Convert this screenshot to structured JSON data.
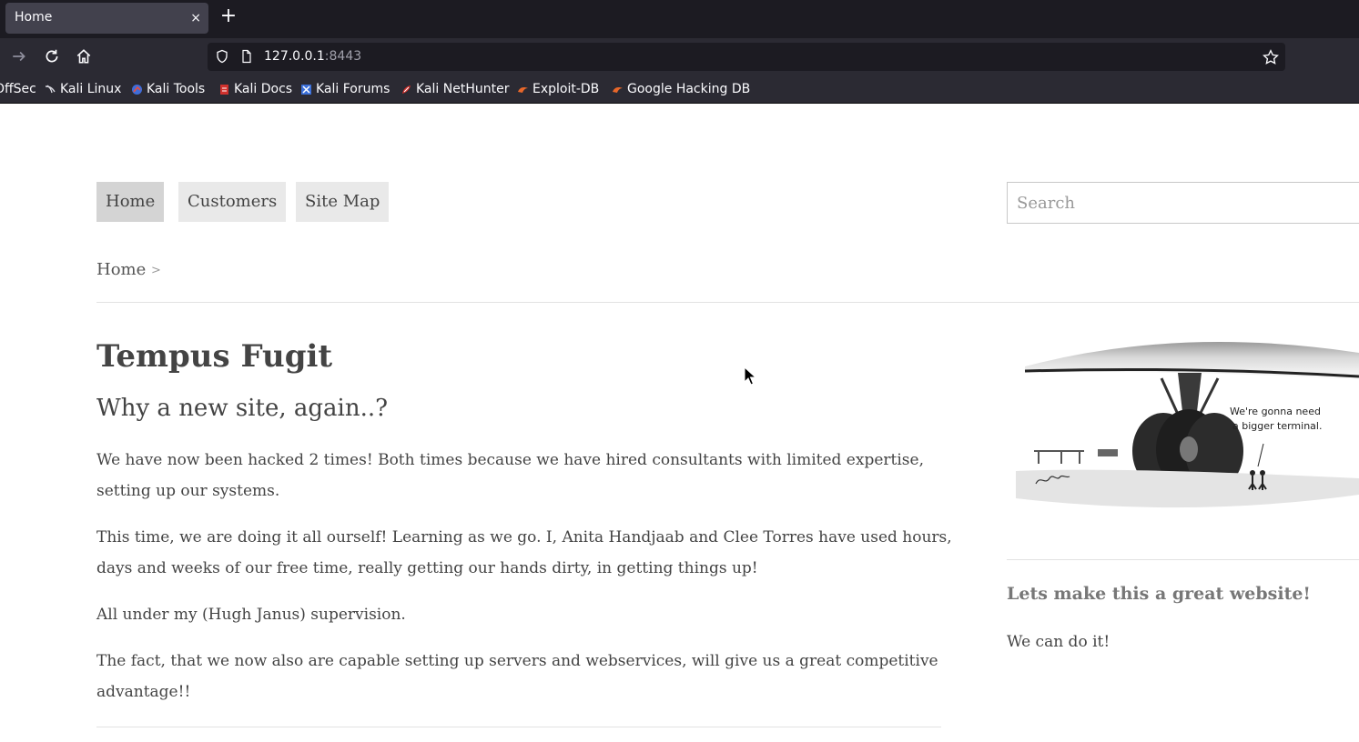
{
  "browser": {
    "tab_title": "Home",
    "tab_close": "×",
    "new_tab": "+",
    "url_host": "127.0.0.1",
    "url_port": ":8443",
    "bookmarks": [
      {
        "label": "OffSec",
        "icon": "offsec-icon"
      },
      {
        "label": "Kali Linux",
        "icon": "kali-dragon-icon"
      },
      {
        "label": "Kali Tools",
        "icon": "kali-tools-icon"
      },
      {
        "label": "Kali Docs",
        "icon": "kali-docs-icon"
      },
      {
        "label": "Kali Forums",
        "icon": "kali-forums-icon"
      },
      {
        "label": "Kali NetHunter",
        "icon": "kali-nethunter-icon"
      },
      {
        "label": "Exploit-DB",
        "icon": "exploit-db-icon"
      },
      {
        "label": "Google Hacking DB",
        "icon": "ghdb-icon"
      }
    ]
  },
  "site": {
    "menu": [
      "Home",
      "Customers",
      "Site Map"
    ],
    "search_placeholder": "Search",
    "breadcrumb": "Home",
    "breadcrumb_sep": ">",
    "title": "Tempus Fugit",
    "subtitle": "Why a new site, again..?",
    "paragraphs": [
      "We have now been hacked 2 times! Both times because we have hired consultants with limited expertise, setting up our systems.",
      "This time, we are doing it all ourself! Learning as we go. I, Anita Handjaab and Clee Torres have used hours, days and weeks of our free time, really getting our hands dirty, in getting things up!",
      "All under my (Hugh Janus) supervision.",
      "The fact, that we now also are capable setting up servers and webservices, will give us a great competitive advantage!!"
    ],
    "cartoon_caption_line1": "We're gonna need",
    "cartoon_caption_line2": "a bigger terminal.",
    "sidebar_heading": "Lets make this a great website!",
    "sidebar_text": "We can do it!"
  },
  "colors": {
    "tabbar_bg": "#1c1b22",
    "toolbar_bg": "#2b2a33",
    "menu_bg": "#e9e9e9",
    "menu_active_bg": "#d4d4d4"
  }
}
